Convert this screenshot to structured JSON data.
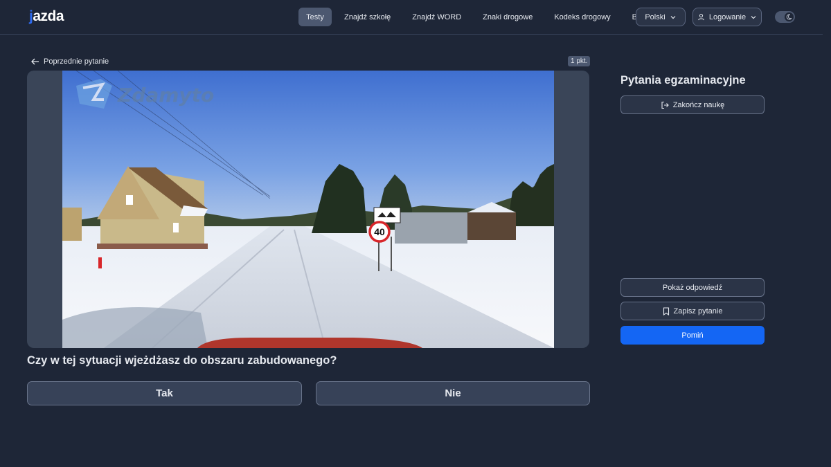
{
  "header": {
    "logo_text": "jazda",
    "nav": [
      "Testy",
      "Znajdź szkołę",
      "Znajdź WORD",
      "Znaki drogowe",
      "Kodeks drogowy",
      "Blog"
    ],
    "active_nav": "Testy",
    "language": "Polski",
    "login": "Logowanie"
  },
  "question_panel": {
    "back_label": "Poprzednie pytanie",
    "points": "1 pkt.",
    "watermark": "Zdamyto",
    "speed_sign": "40",
    "question": "Czy w tej sytuacji wjeżdżasz do obszaru zabudowanego?",
    "answers": {
      "yes": "Tak",
      "no": "Nie"
    }
  },
  "sidebar": {
    "title": "Pytania egzaminacyjne",
    "end_label": "Zakończ naukę",
    "show_answer": "Pokaż odpowiedź",
    "save_question": "Zapisz pytanie",
    "skip": "Pomiń"
  },
  "colors": {
    "background": "#1e2637",
    "accent": "#1466f4",
    "logo_accent": "#2f6cf0"
  },
  "icons": [
    "arrow-left-icon",
    "chevron-down-icon",
    "user-icon",
    "moon-icon",
    "logout-icon",
    "bookmark-icon"
  ]
}
